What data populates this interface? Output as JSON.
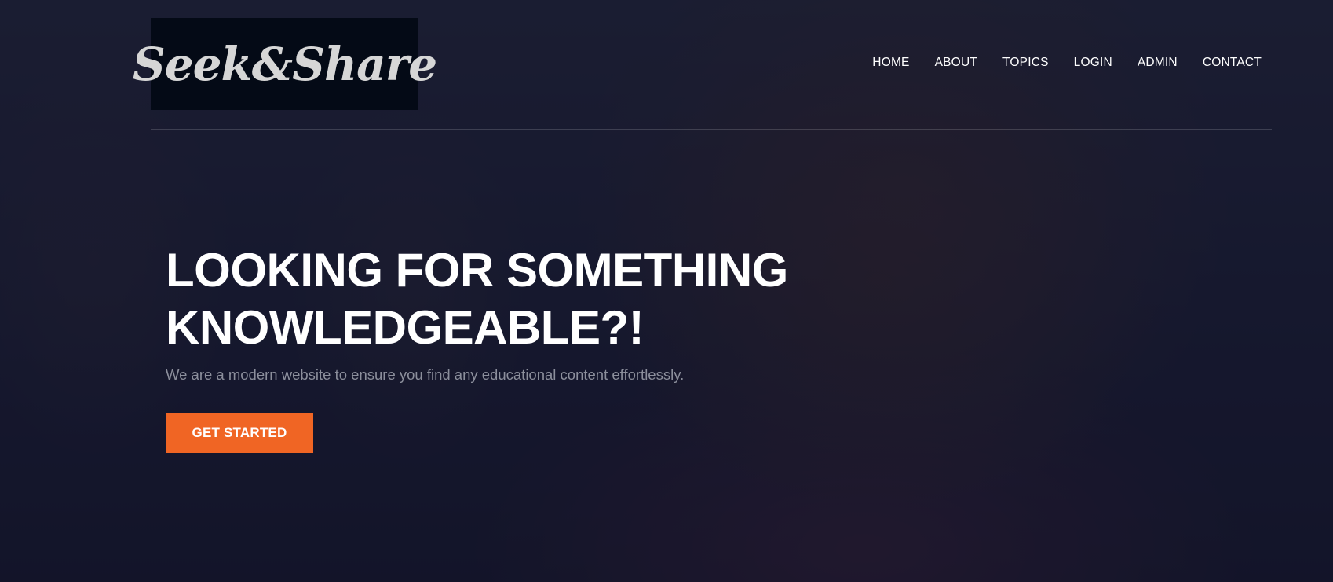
{
  "brand": {
    "logo_text": "Seek&Share"
  },
  "nav": {
    "items": [
      "HOME",
      "ABOUT",
      "TOPICS",
      "LOGIN",
      "ADMIN",
      "CONTACT"
    ]
  },
  "hero": {
    "headline_line1": "LOOKING FOR SOMETHING",
    "headline_line2": "KNOWLEDGEABLE?!",
    "subtitle": "We are a modern website to ensure you find any educational content effortlessly.",
    "cta_label": "GET STARTED"
  },
  "colors": {
    "accent": "#f06524",
    "overlay": "#0c0e26",
    "logo_bg": "#040a16",
    "text": "#ffffff",
    "subtitle": "#8c8f9c"
  }
}
